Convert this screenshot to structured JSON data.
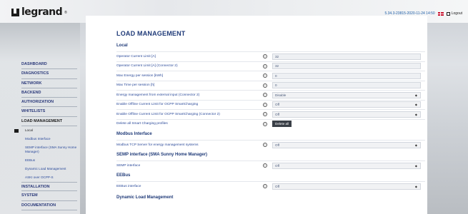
{
  "header": {
    "brand": "legrand",
    "version": "5.34.3-23815-2020-11-24 14:50",
    "logout_label": "Logout"
  },
  "nav": {
    "items": [
      {
        "label": "DASHBOARD"
      },
      {
        "label": "DIAGNOSTICS"
      },
      {
        "label": "NETWORK"
      },
      {
        "label": "BACKEND"
      },
      {
        "label": "AUTHORIZATION"
      },
      {
        "label": "WHITELISTS"
      },
      {
        "label": "LOAD MANAGEMENT"
      }
    ],
    "sub_items": [
      {
        "label": "Local"
      },
      {
        "label": "Modbus Interface"
      },
      {
        "label": "SEMP interface (SMA Sunny Home Manager)"
      },
      {
        "label": "EEBus"
      },
      {
        "label": "Dynamic Load Management"
      },
      {
        "label": "ASKI over OCPP-S"
      }
    ],
    "items_after": [
      {
        "label": "INSTALLATION"
      },
      {
        "label": "SYSTEM"
      },
      {
        "label": "DOCUMENTATION"
      }
    ]
  },
  "main": {
    "title": "LOAD MANAGEMENT",
    "sections": {
      "local": "Local",
      "modbus": "Modbus Interface",
      "semp": "SEMP interface (SMA Sunny Home Manager)",
      "eebus": "EEBus",
      "dynamic": "Dynamic Load Management"
    },
    "local_rows": [
      {
        "label": "Operator Current Limit [A]",
        "value": "32"
      },
      {
        "label": "Operator Current Limit [A] (Connector 2)",
        "value": "32"
      },
      {
        "label": "Max Energy per session [kWh]",
        "value": "0"
      },
      {
        "label": "Max Time per session [h]",
        "value": "0"
      },
      {
        "label": "Energy management from external input (Connector 2)",
        "value": "Disable"
      },
      {
        "label": "Enable Offline Current Limit for OCPP SmartCharging",
        "value": "Off"
      },
      {
        "label": "Enable Offline Current Limit for OCPP SmartCharging (Connector 2)",
        "value": "Off"
      },
      {
        "label": "Delete all Smart Charging profiles",
        "button": "Delete all"
      }
    ],
    "modbus_row": {
      "label": "Modbus TCP Server for energy management systems",
      "value": "Off"
    },
    "semp_row": {
      "label": "SEMP interface",
      "value": "Off"
    },
    "eebus_row": {
      "label": "EEBus interface",
      "value": "Off"
    }
  }
}
